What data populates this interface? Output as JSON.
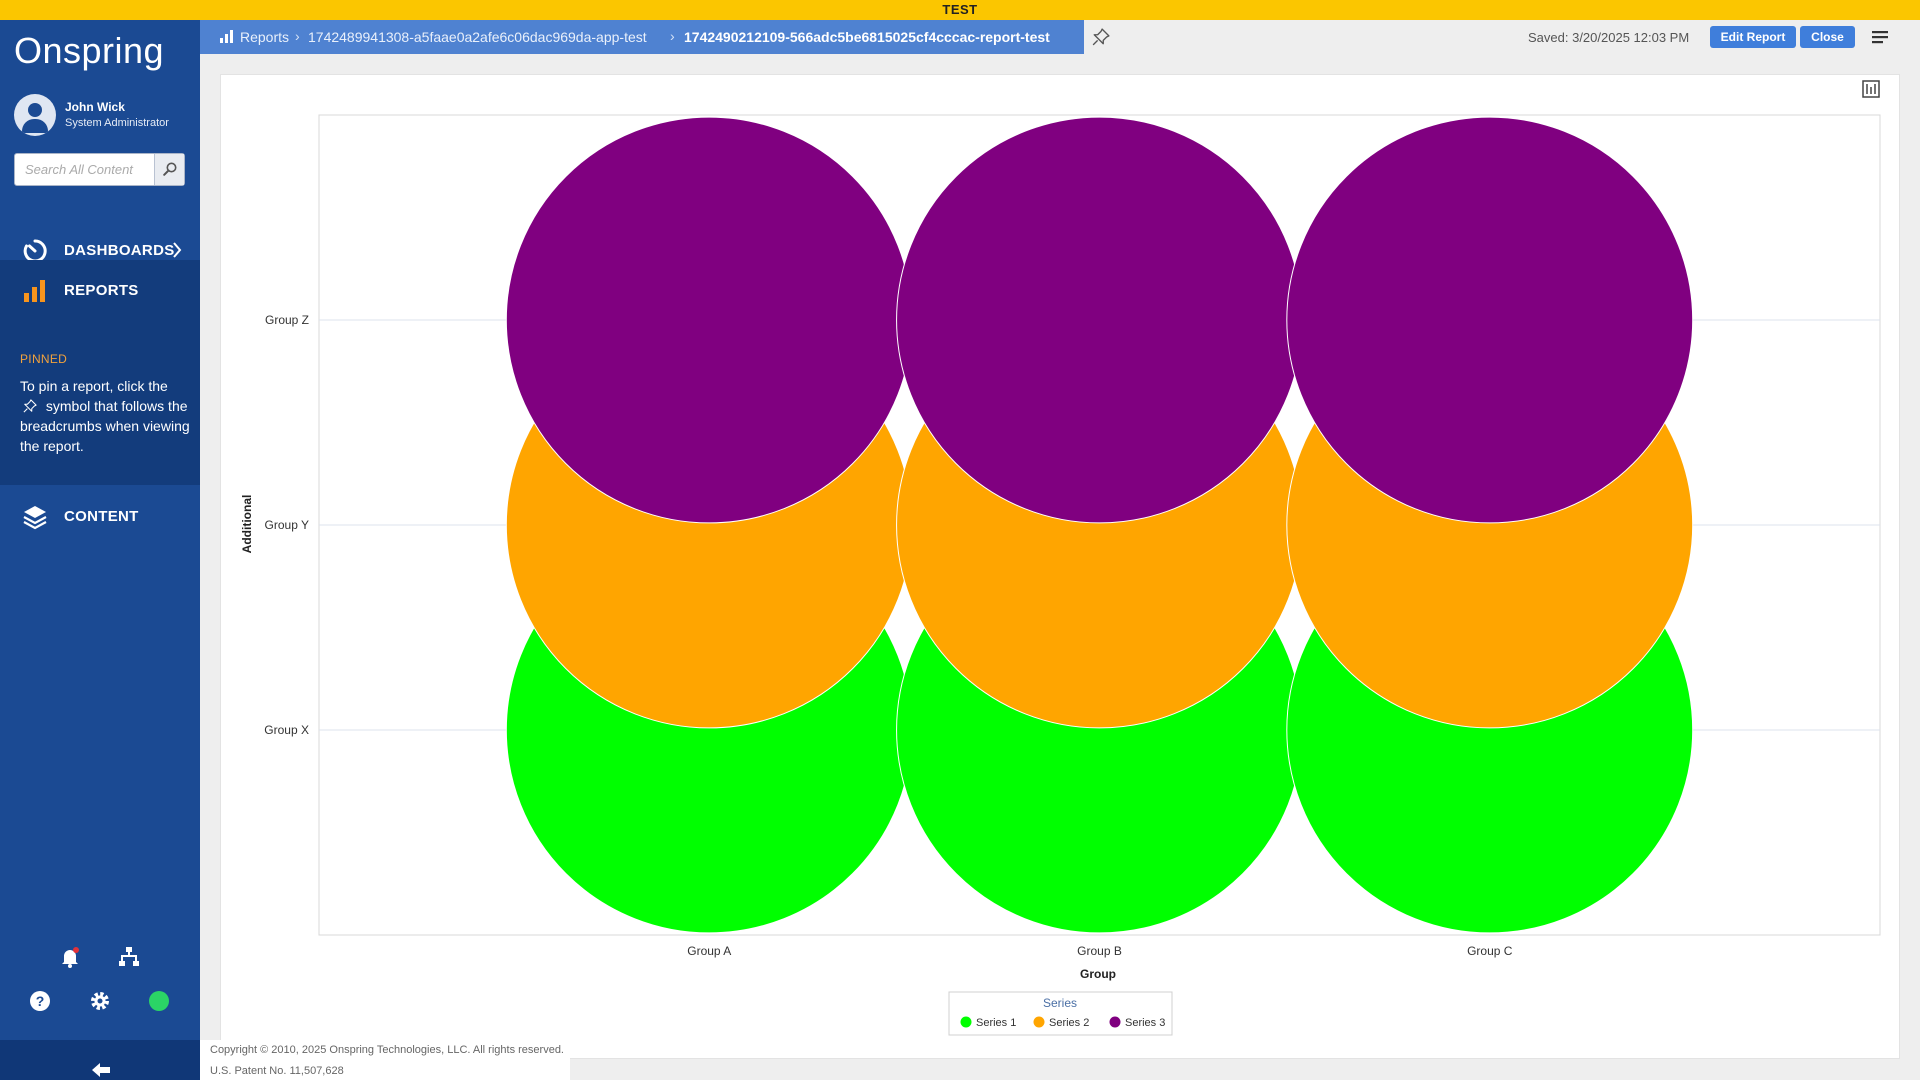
{
  "env_banner": "TEST",
  "sidebar": {
    "logo": "Onspring",
    "user": {
      "name": "John Wick",
      "role": "System Administrator"
    },
    "search": {
      "placeholder": "Search All Content"
    },
    "nav": {
      "dashboards": "DASHBOARDS",
      "reports": "REPORTS",
      "content": "CONTENT"
    },
    "pinned": {
      "heading": "PINNED",
      "text_before": "To pin a report, click the",
      "text_after": "symbol that follows the breadcrumbs when viewing the report."
    },
    "footer_icons": [
      "bell-icon",
      "sitemap-icon",
      "help-icon",
      "gear-icon",
      "status-online"
    ],
    "colors": {
      "background": "#1b4a93",
      "active": "#133c7c",
      "accent": "#f2a23c",
      "status": "#2bd466"
    }
  },
  "header": {
    "breadcrumbs": [
      "Reports",
      "1742489941308-a5faae0a2afe6c06dac969da-app-test",
      "1742490212109-566adc5be6815025cf4cccac-report-test"
    ],
    "saved": "Saved: 3/20/2025 12:03 PM",
    "edit_label": "Edit Report",
    "close_label": "Close"
  },
  "footer": {
    "copyright": "Copyright © 2010, 2025 Onspring Technologies, LLC. All rights reserved.",
    "patent": "U.S. Patent No. 11,507,628"
  },
  "chart_data": {
    "type": "scatter",
    "xlabel": "Group",
    "ylabel": "Additional",
    "categories": [
      "Group A",
      "Group B",
      "Group C"
    ],
    "y_categories": [
      "Group X",
      "Group Y",
      "Group Z"
    ],
    "legend_title": "Series",
    "legend_position": "bottom-center",
    "grid": true,
    "series": [
      {
        "name": "Series 1",
        "color": "#00ff00",
        "points": [
          {
            "x": "Group A",
            "y": "Group X"
          },
          {
            "x": "Group B",
            "y": "Group X"
          },
          {
            "x": "Group C",
            "y": "Group X"
          }
        ]
      },
      {
        "name": "Series 2",
        "color": "#ffa500",
        "points": [
          {
            "x": "Group A",
            "y": "Group Y"
          },
          {
            "x": "Group B",
            "y": "Group Y"
          },
          {
            "x": "Group C",
            "y": "Group Y"
          }
        ]
      },
      {
        "name": "Series 3",
        "color": "#800080",
        "points": [
          {
            "x": "Group A",
            "y": "Group Z"
          },
          {
            "x": "Group B",
            "y": "Group Z"
          },
          {
            "x": "Group C",
            "y": "Group Z"
          }
        ]
      }
    ]
  }
}
